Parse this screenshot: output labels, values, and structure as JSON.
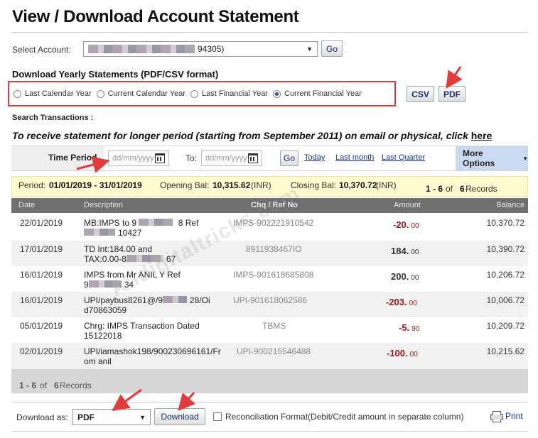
{
  "page": {
    "title": "View / Download Account Statement"
  },
  "account": {
    "label": "Select Account:",
    "value_suffix": "94305)",
    "go_label": "Go"
  },
  "yearly": {
    "heading": "Download Yearly Statements (PDF/CSV format)",
    "options": [
      "Last Calendar Year",
      "Current Calendar Year",
      "Last Financial Year",
      "Current Financial Year"
    ],
    "selected": "Current Financial Year",
    "csv_label": "CSV",
    "pdf_label": "PDF"
  },
  "search": {
    "heading": "Search Transactions :",
    "promo_text": "To receive statement for longer period (starting from September 2011) on email or physical, click ",
    "promo_link": "here"
  },
  "filter": {
    "time_period_label": "Time Period",
    "from_placeholder": "dd/mm/yyyy",
    "to_label": "To:",
    "to_placeholder": "dd/mm/yyyy",
    "go_label": "Go",
    "quick_links": [
      "Today",
      "Last month",
      "Last Quarter"
    ],
    "more_options_label": "More Options"
  },
  "summary": {
    "period_label": "Period:",
    "period_value": "01/01/2019 - 31/01/2019",
    "opening_label": "Opening Bal:",
    "opening_value": "10,315.62",
    "opening_unit": "(INR)",
    "closing_label": "Closing Bal:",
    "closing_value": "10,370.72",
    "closing_unit": "(INR)",
    "range": "1 - 6",
    "of_label": "of",
    "total": "6",
    "records_label": "Records"
  },
  "table": {
    "headers": [
      "Date",
      "Description",
      "Chq / Ref No",
      "Amount",
      "Balance"
    ],
    "rows": [
      {
        "date": "22/01/2019",
        "desc1": "MB:IMPS to 9",
        "desc1b": "8 Ref",
        "desc2": "10427",
        "ref": "IMPS-902221910542",
        "amount": "-20.",
        "paise": "00",
        "negative": true,
        "balance": "10,370.72"
      },
      {
        "date": "17/01/2019",
        "desc1": "TD Int:184.00 and",
        "desc1b": "",
        "desc2": "TAX:0.00-8",
        "desc2b": "67",
        "ref": "8911938467IO",
        "amount": "184.",
        "paise": "00",
        "negative": false,
        "balance": "10,390.72"
      },
      {
        "date": "16/01/2019",
        "desc1": "IMPS from Mr ANIL Y Ref",
        "desc1b": "",
        "desc2": "9",
        "desc2b": "34",
        "ref": "IMPS-901618685808",
        "amount": "200.",
        "paise": "00",
        "negative": false,
        "balance": "10,206.72"
      },
      {
        "date": "16/01/2019",
        "desc1": "UPI/paybus8261@/9",
        "desc1b": "28/Oi",
        "desc2": "d70863059",
        "ref": "UPI-901618062586",
        "amount": "-203.",
        "paise": "00",
        "negative": true,
        "balance": "10,006.72"
      },
      {
        "date": "05/01/2019",
        "desc1": "Chrg: IMPS Transaction Dated",
        "desc1b": "",
        "desc2": "15122018",
        "ref": "TBMS",
        "amount": "-5.",
        "paise": "90",
        "negative": true,
        "balance": "10,209.72"
      },
      {
        "date": "02/01/2019",
        "desc1": "UPI/iamashok198/900230696161/Fr",
        "desc1b": "",
        "desc2": "om anil",
        "ref": "UPI-900215546488",
        "amount": "-100.",
        "paise": "00",
        "negative": true,
        "balance": "10,215.62"
      }
    ]
  },
  "footer": {
    "range": "1 - 6",
    "of_label": "of",
    "total": "6",
    "records_label": "Records",
    "download_as_label": "Download as:",
    "format_value": "PDF",
    "download_label": "Download",
    "reconciliation_label": "Reconciliation Format(Debit/Credit amount in separate column)",
    "print_label": "Print"
  },
  "watermark": "Alldigitaltricks.com",
  "colors": {
    "annotation_red": "#e23b3b",
    "debit_red": "#a01818",
    "summary_yellow": "#fdfbcf",
    "header_grey": "#6f6f6f",
    "more_options_blue": "#c9d9f0"
  }
}
